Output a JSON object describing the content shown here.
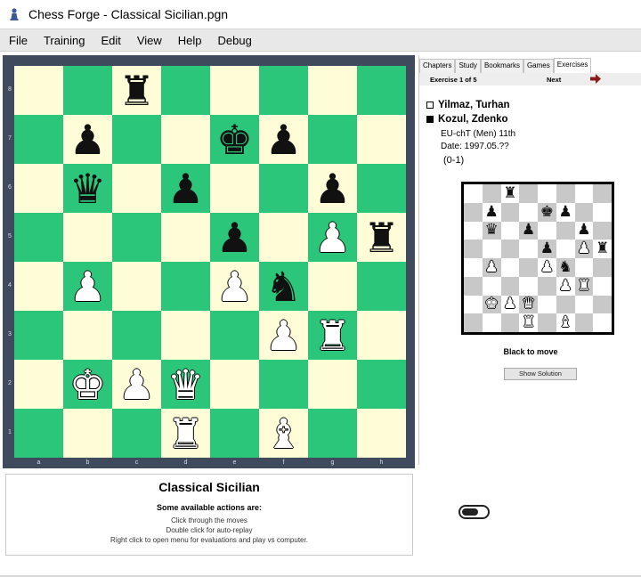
{
  "window": {
    "title": "Chess Forge - Classical Sicilian.pgn",
    "app_icon": "pawn-icon"
  },
  "menu": [
    "File",
    "Training",
    "Edit",
    "View",
    "Help",
    "Debug"
  ],
  "board": {
    "colors": {
      "light": "#fffcd8",
      "dark": "#2bc67a",
      "frame": "#3f4a5c"
    },
    "ranks": [
      "8",
      "7",
      "6",
      "5",
      "4",
      "3",
      "2",
      "1"
    ],
    "files": [
      "a",
      "b",
      "c",
      "d",
      "e",
      "f",
      "g",
      "h"
    ],
    "position": [
      [
        "",
        "",
        "r",
        "",
        "",
        "",
        "",
        ""
      ],
      [
        "",
        "p",
        "",
        "",
        "k",
        "p",
        "",
        ""
      ],
      [
        "",
        "q",
        "",
        "p",
        "",
        "",
        "p",
        ""
      ],
      [
        "",
        "",
        "",
        "",
        "p",
        "",
        "P",
        "r"
      ],
      [
        "",
        "P",
        "",
        "",
        "P",
        "n",
        "",
        ""
      ],
      [
        "",
        "",
        "",
        "",
        "",
        "P",
        "R",
        ""
      ],
      [
        "",
        "K",
        "P",
        "Q",
        "",
        "",
        "",
        ""
      ],
      [
        "",
        "",
        "",
        "R",
        "",
        "B",
        "",
        ""
      ]
    ]
  },
  "tabs": [
    {
      "label": "Chapters",
      "active": false
    },
    {
      "label": "Study",
      "active": false
    },
    {
      "label": "Bookmarks",
      "active": false
    },
    {
      "label": "Games",
      "active": false
    },
    {
      "label": "Exercises",
      "active": true
    }
  ],
  "exercise": {
    "counter": "Exercise 1 of 5",
    "next_label": "Next",
    "next_icon": "arrow-right-icon",
    "white_player": "Yilmaz, Turhan",
    "black_player": "Kozul, Zdenko",
    "event": "EU-chT (Men) 11th",
    "date": "Date: 1997.05.??",
    "result": "(0-1)",
    "to_move": "Black to move",
    "show_solution": "Show Solution"
  },
  "info": {
    "title": "Classical Sicilian",
    "subtitle": "Some available actions are:",
    "lines": [
      "Click through the moves",
      "Double click for auto-replay",
      "Right click to open menu for evaluations and play vs computer."
    ]
  },
  "toggle": {
    "state": "off"
  }
}
